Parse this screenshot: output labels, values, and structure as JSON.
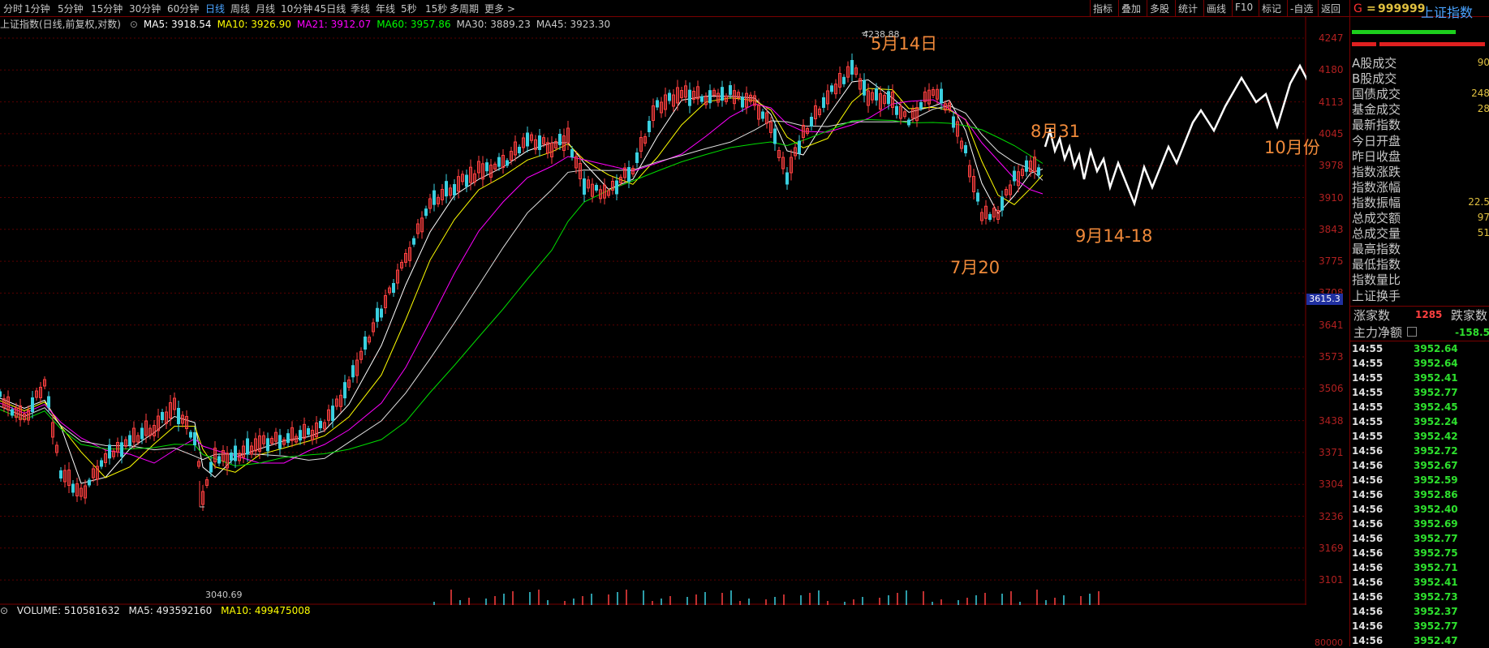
{
  "toolbar": {
    "periods": [
      "分时",
      "1分钟",
      "5分钟",
      "15分钟",
      "30分钟",
      "60分钟",
      "日线",
      "周线",
      "月线",
      "10分钟",
      "45日线",
      "季线",
      "年线",
      "5秒",
      "15秒",
      "多周期",
      "更多 >"
    ],
    "active": "日线",
    "right_tools": [
      "指标",
      "叠加",
      "多股",
      "统计",
      "画线",
      "F10",
      "标记",
      "-自选",
      "返回"
    ]
  },
  "header": {
    "title": "上证指数(日线,前复权,对数)",
    "ma": [
      {
        "label": "MA5: 3918.54",
        "color": "#ffffff"
      },
      {
        "label": "MA10: 3926.90",
        "color": "#ffff00"
      },
      {
        "label": "MA21: 3912.07",
        "color": "#ff00ff"
      },
      {
        "label": "MA60: 3957.86",
        "color": "#00ff00"
      },
      {
        "label": "MA30: 3889.23",
        "color": "#c8c8c8"
      },
      {
        "label": "MA45: 3923.30",
        "color": "#c8c8c8"
      }
    ]
  },
  "y_axis": [
    "4247",
    "4180",
    "4113",
    "4045",
    "3978",
    "3910",
    "3843",
    "3775",
    "3708",
    "3641",
    "3573",
    "3506",
    "3438",
    "3371",
    "3304",
    "3236",
    "3169",
    "3101"
  ],
  "current_price_tag": "3615.3",
  "chart_labels": {
    "high": "4238.88",
    "low": "3040.69"
  },
  "annotations": {
    "may14": "5月14日",
    "aug31": "8月31",
    "sep": "9月14-18",
    "jul20": "7月20",
    "oct": "10月份"
  },
  "volume": {
    "label": "VOLUME: 510581632",
    "ma5": "MA5: 493592160",
    "ma10": "MA10: 499475008",
    "axis_label": "80000"
  },
  "panel": {
    "code_prefix": "G",
    "code": "999999",
    "name": "上证指数",
    "labels": [
      "A股成交",
      "B股成交",
      "国债成交",
      "基金成交",
      "最新指数",
      "今日开盘",
      "昨日收盘",
      "指数涨跌",
      "指数涨幅",
      "指数振幅",
      "总成交额",
      "总成交量",
      "最高指数",
      "最低指数",
      "指数量比",
      "上证换手"
    ],
    "values": [
      "90",
      "",
      "248",
      "28",
      "",
      "",
      "",
      "",
      "",
      "22.5",
      "97",
      "51",
      "",
      "",
      "",
      ""
    ],
    "up_label": "涨家数",
    "up_count": "1285",
    "down_label": "跌家数",
    "net_label": "主力净额",
    "net_value": "-158.5",
    "ticks": [
      {
        "t": "14:55",
        "p": "3952.64"
      },
      {
        "t": "14:55",
        "p": "3952.64"
      },
      {
        "t": "14:55",
        "p": "3952.41"
      },
      {
        "t": "14:55",
        "p": "3952.77"
      },
      {
        "t": "14:55",
        "p": "3952.45"
      },
      {
        "t": "14:55",
        "p": "3952.24"
      },
      {
        "t": "14:55",
        "p": "3952.42"
      },
      {
        "t": "14:56",
        "p": "3952.72"
      },
      {
        "t": "14:56",
        "p": "3952.67"
      },
      {
        "t": "14:56",
        "p": "3952.59"
      },
      {
        "t": "14:56",
        "p": "3952.86"
      },
      {
        "t": "14:56",
        "p": "3952.40"
      },
      {
        "t": "14:56",
        "p": "3952.69"
      },
      {
        "t": "14:56",
        "p": "3952.77"
      },
      {
        "t": "14:56",
        "p": "3952.75"
      },
      {
        "t": "14:56",
        "p": "3952.71"
      },
      {
        "t": "14:56",
        "p": "3952.41"
      },
      {
        "t": "14:56",
        "p": "3952.73"
      },
      {
        "t": "14:56",
        "p": "3952.37"
      },
      {
        "t": "14:56",
        "p": "3952.77"
      },
      {
        "t": "14:56",
        "p": "3952.47"
      }
    ]
  }
}
